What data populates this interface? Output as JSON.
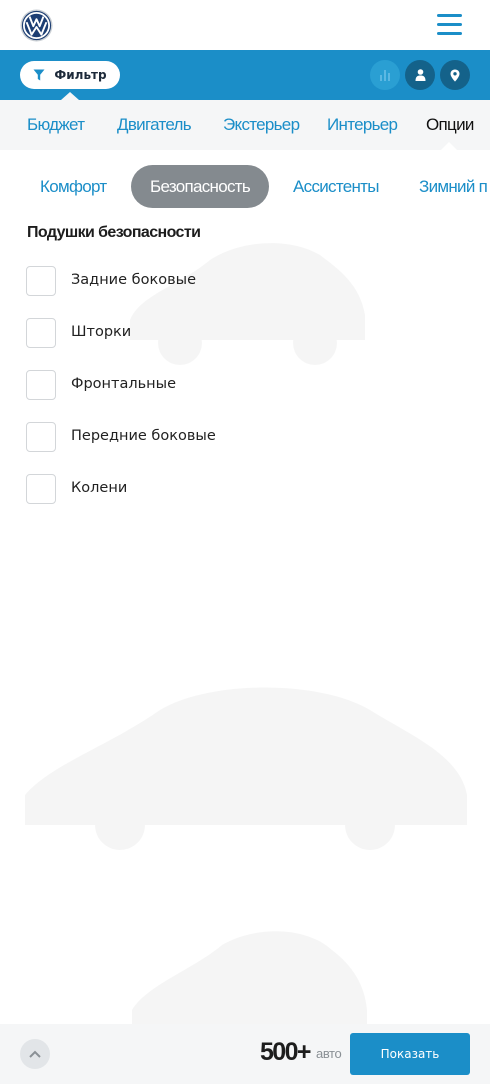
{
  "brand": {
    "logo_icon": "vw-logo-icon",
    "accent": "#1b8ec8"
  },
  "header": {
    "menu_icon": "hamburger-menu-icon"
  },
  "filterbar": {
    "filter_label": "Фильтр",
    "filter_icon": "funnel-icon",
    "actions": [
      "bar-chart-icon",
      "user-icon",
      "map-marker-icon"
    ]
  },
  "tabs": [
    "Бюджет",
    "Двигатель",
    "Экстерьер",
    "Интерьер",
    "Опции"
  ],
  "active_tab": "Опции",
  "subtabs": [
    "Комфорт",
    "Безопасность",
    "Ассистенты",
    "Зимний п"
  ],
  "active_subtab": "Безопасность",
  "section": {
    "title": "Подушки безопасности",
    "options": [
      "Задние боковые",
      "Шторки",
      "Фронтальные",
      "Передние боковые",
      "Колени"
    ]
  },
  "footer": {
    "count": "500+",
    "count_unit": "авто",
    "show_label": "Показать",
    "up_icon": "chevron-up-icon"
  }
}
